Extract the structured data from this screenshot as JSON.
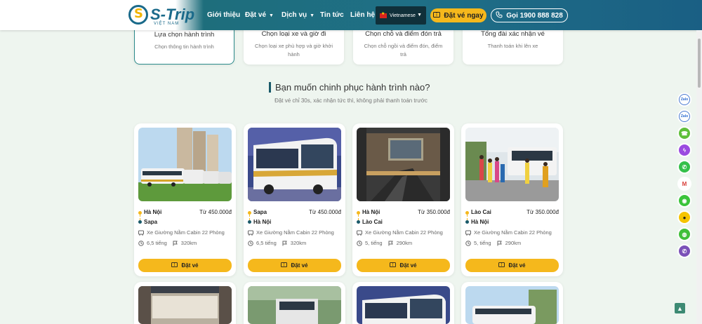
{
  "header": {
    "logo_text": "S-Trip",
    "logo_sub": "VIỆT NAM",
    "nav": [
      {
        "label": "Giới thiệu",
        "has_caret": false
      },
      {
        "label": "Đặt vé",
        "has_caret": true
      },
      {
        "label": "Dịch vụ",
        "has_caret": true
      },
      {
        "label": "Tin tức",
        "has_caret": false
      },
      {
        "label": "Liên hệ",
        "has_caret": false
      }
    ],
    "language": "Vietnamese",
    "book_now": "Đặt vé ngay",
    "call": "Gọi 1900 888 828"
  },
  "steps": [
    {
      "title": "Lựa chọn hành trình",
      "desc": "Chọn thông tin hành trình"
    },
    {
      "title": "Chọn loại xe và giờ đi",
      "desc": "Chọn loại xe phù hợp và giờ khởi hành"
    },
    {
      "title": "Chọn chỗ và điểm đón trả",
      "desc": "Chọn chỗ ngồi và điểm đón, điểm trả"
    },
    {
      "title": "Tổng đài xác nhận vé",
      "desc": "Thanh toán khi lên xe"
    }
  ],
  "section": {
    "title": "Bạn muốn chinh phục hành trình nào?",
    "subtitle": "Đặt vé chỉ 30s, xác nhận tức thì, không phải thanh toán trước"
  },
  "routes": [
    {
      "from": "Hà Nội",
      "to": "Sapa",
      "price": "Từ 450.000đ",
      "bus": "Xe Giường Nằm Cabin 22 Phòng",
      "duration": "6,5 tiếng",
      "distance": "320km",
      "book": "Đặt vé"
    },
    {
      "from": "Sapa",
      "to": "Hà Nội",
      "price": "Từ 450.000đ",
      "bus": "Xe Giường Nằm Cabin 22 Phòng",
      "duration": "6,5 tiếng",
      "distance": "320km",
      "book": "Đặt vé"
    },
    {
      "from": "Hà Nội",
      "to": "Lào Cai",
      "price": "Từ 350.000đ",
      "bus": "Xe Giường Nằm Cabin 22 Phòng",
      "duration": "5, tiếng",
      "distance": "290km",
      "book": "Đặt vé"
    },
    {
      "from": "Lào Cai",
      "to": "Hà Nội",
      "price": "Từ 350.000đ",
      "bus": "Xe Giường Nằm Cabin 22 Phòng",
      "duration": "5, tiếng",
      "distance": "290km",
      "book": "Đặt vé"
    }
  ],
  "fabs": [
    {
      "icon": "zalo-icon",
      "color": "#ffffff"
    },
    {
      "icon": "zalo-icon",
      "color": "#ffffff"
    },
    {
      "icon": "phone-icon",
      "color": "#5fbf3a"
    },
    {
      "icon": "messenger-icon",
      "color": "#9b4be0"
    },
    {
      "icon": "whatsapp-icon",
      "color": "#35c04a"
    },
    {
      "icon": "gmail-icon",
      "color": "#ffffff"
    },
    {
      "icon": "line-icon",
      "color": "#3ac43a"
    },
    {
      "icon": "chat-icon",
      "color": "#f5c400"
    },
    {
      "icon": "wechat-icon",
      "color": "#40bf3a"
    },
    {
      "icon": "viber-icon",
      "color": "#7b51b8"
    }
  ]
}
